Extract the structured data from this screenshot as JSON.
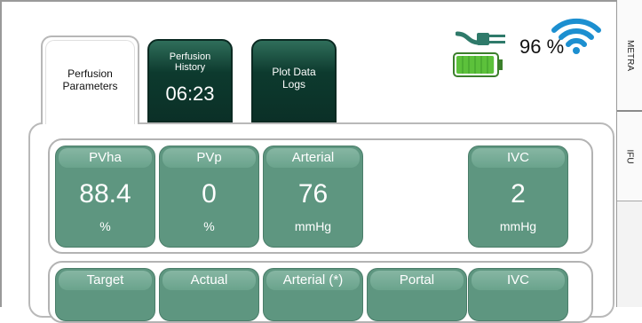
{
  "tabs": {
    "perfusion_parameters": "Perfusion Parameters",
    "perfusion_history": "Perfusion History",
    "history_time": "06:23",
    "plot_data_logs": "Plot Data Logs"
  },
  "status": {
    "battery_percent": "96 %",
    "battery_level": 0.96,
    "plug_connected": true
  },
  "side_panel": {
    "tab1": "METRA",
    "tab2": "IFU"
  },
  "parameters": [
    {
      "label": "PVha",
      "value": "88.4",
      "unit": "%"
    },
    {
      "label": "PVp",
      "value": "0",
      "unit": "%"
    },
    {
      "label": "Arterial",
      "value": "76",
      "unit": "mmHg"
    },
    {
      "label": "IVC",
      "value": "2",
      "unit": "mmHg"
    }
  ],
  "pressure_headers": [
    "Target",
    "Actual",
    "Arterial (*)",
    "Portal",
    "IVC"
  ],
  "colors": {
    "tile": "#5e9680",
    "tab_dark": "#0d3a2e",
    "battery": "#5cc13b",
    "wifi": "#1c8fd0"
  }
}
